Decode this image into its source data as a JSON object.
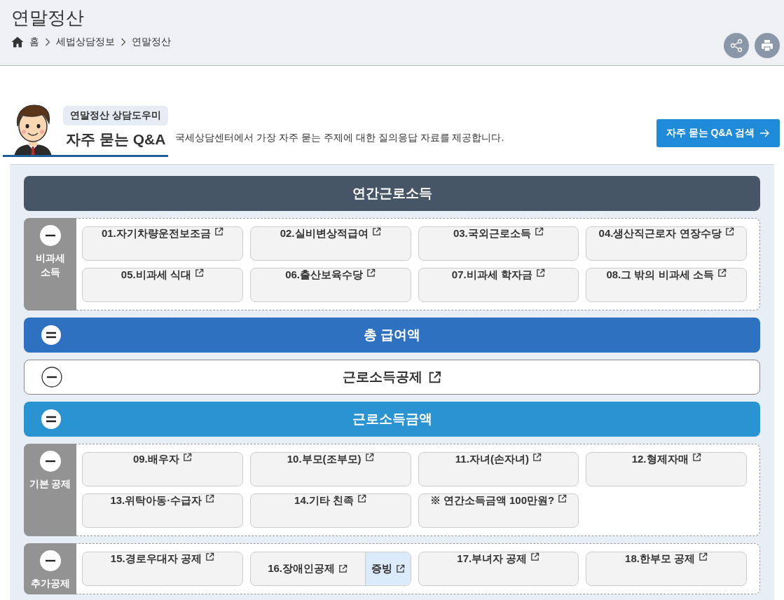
{
  "page_title": "연말정산",
  "breadcrumb": [
    "홈",
    "세법상담정보",
    "연말정산"
  ],
  "intro": {
    "badge": "연말정산 상담도우미",
    "title": "자주 묻는 Q&A",
    "description": "국세상담센터에서 가장 자주 묻는 주제에 대한 질의응답 자료를 제공합니다.",
    "search_button": "자주 묻는 Q&A 검색"
  },
  "sections": [
    {
      "kind": "title",
      "label": "연간근로소득",
      "external_link": false
    },
    {
      "kind": "group",
      "label": "비과세 소득",
      "items": [
        {
          "label": "01.자기차량운전보조금"
        },
        {
          "label": "02.실비변상적급여"
        },
        {
          "label": "03.국외근로소득"
        },
        {
          "label": "04.생산직근로자 연장수당"
        },
        {
          "label": "05.비과세 식대"
        },
        {
          "label": "06.출산보육수당"
        },
        {
          "label": "07.비과세 학자금"
        },
        {
          "label": "08.그 밖의 비과세 소득"
        }
      ]
    },
    {
      "kind": "total",
      "label": "총 급여액",
      "external_link": false
    },
    {
      "kind": "deduction",
      "label": "근로소득공제",
      "external_link": true
    },
    {
      "kind": "amount",
      "label": "근로소득금액",
      "external_link": false
    },
    {
      "kind": "group",
      "label": "기본 공제",
      "items": [
        {
          "label": "09.배우자"
        },
        {
          "label": "10.부모(조부모)"
        },
        {
          "label": "11.자녀(손자녀)"
        },
        {
          "label": "12.형제자매"
        },
        {
          "label": "13.위탁아동·수급자"
        },
        {
          "label": "14.기타 친족"
        },
        {
          "label": "※ 연간소득금액 100만원?"
        }
      ]
    },
    {
      "kind": "group",
      "label": "추가공제",
      "items": [
        {
          "label": "15.경로우대자 공제"
        },
        {
          "label": "16.장애인공제",
          "sub_link": "증빙"
        },
        {
          "label": "17.부녀자 공제"
        },
        {
          "label": "18.한부모 공제"
        }
      ]
    }
  ]
}
